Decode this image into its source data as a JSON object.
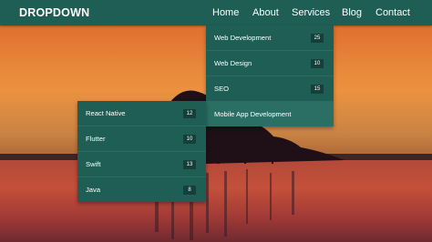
{
  "logo": "DROPDOWN",
  "nav": [
    {
      "label": "Home"
    },
    {
      "label": "About"
    },
    {
      "label": "Services"
    },
    {
      "label": "Blog"
    },
    {
      "label": "Contact"
    }
  ],
  "services_menu": [
    {
      "label": "Web Development",
      "count": "25"
    },
    {
      "label": "Web Design",
      "count": "10"
    },
    {
      "label": "SEO",
      "count": "15"
    },
    {
      "label": "Mobile App Development",
      "count": ""
    }
  ],
  "mobile_submenu": [
    {
      "label": "React Native",
      "count": "12"
    },
    {
      "label": "Flutter",
      "count": "10"
    },
    {
      "label": "Swift",
      "count": "13"
    },
    {
      "label": "Java",
      "count": "8"
    }
  ],
  "colors": {
    "navbar": "#1f5e55",
    "menu": "#1f5e55",
    "badge": "#143f3a",
    "active_item": "#2a6e64"
  }
}
